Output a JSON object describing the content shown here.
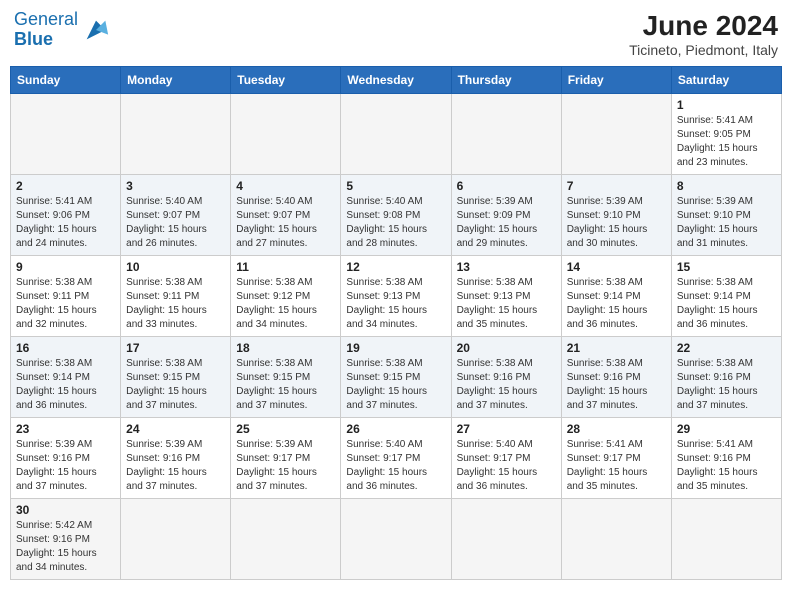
{
  "header": {
    "logo_general": "General",
    "logo_blue": "Blue",
    "title": "June 2024",
    "subtitle": "Ticineto, Piedmont, Italy"
  },
  "weekdays": [
    "Sunday",
    "Monday",
    "Tuesday",
    "Wednesday",
    "Thursday",
    "Friday",
    "Saturday"
  ],
  "weeks": [
    {
      "days": [
        {
          "num": "",
          "info": ""
        },
        {
          "num": "",
          "info": ""
        },
        {
          "num": "",
          "info": ""
        },
        {
          "num": "",
          "info": ""
        },
        {
          "num": "",
          "info": ""
        },
        {
          "num": "",
          "info": ""
        },
        {
          "num": "1",
          "info": "Sunrise: 5:41 AM\nSunset: 9:05 PM\nDaylight: 15 hours and 23 minutes."
        }
      ]
    },
    {
      "days": [
        {
          "num": "2",
          "info": "Sunrise: 5:41 AM\nSunset: 9:06 PM\nDaylight: 15 hours and 24 minutes."
        },
        {
          "num": "3",
          "info": "Sunrise: 5:40 AM\nSunset: 9:07 PM\nDaylight: 15 hours and 26 minutes."
        },
        {
          "num": "4",
          "info": "Sunrise: 5:40 AM\nSunset: 9:07 PM\nDaylight: 15 hours and 27 minutes."
        },
        {
          "num": "5",
          "info": "Sunrise: 5:40 AM\nSunset: 9:08 PM\nDaylight: 15 hours and 28 minutes."
        },
        {
          "num": "6",
          "info": "Sunrise: 5:39 AM\nSunset: 9:09 PM\nDaylight: 15 hours and 29 minutes."
        },
        {
          "num": "7",
          "info": "Sunrise: 5:39 AM\nSunset: 9:10 PM\nDaylight: 15 hours and 30 minutes."
        },
        {
          "num": "8",
          "info": "Sunrise: 5:39 AM\nSunset: 9:10 PM\nDaylight: 15 hours and 31 minutes."
        }
      ]
    },
    {
      "days": [
        {
          "num": "9",
          "info": "Sunrise: 5:38 AM\nSunset: 9:11 PM\nDaylight: 15 hours and 32 minutes."
        },
        {
          "num": "10",
          "info": "Sunrise: 5:38 AM\nSunset: 9:11 PM\nDaylight: 15 hours and 33 minutes."
        },
        {
          "num": "11",
          "info": "Sunrise: 5:38 AM\nSunset: 9:12 PM\nDaylight: 15 hours and 34 minutes."
        },
        {
          "num": "12",
          "info": "Sunrise: 5:38 AM\nSunset: 9:13 PM\nDaylight: 15 hours and 34 minutes."
        },
        {
          "num": "13",
          "info": "Sunrise: 5:38 AM\nSunset: 9:13 PM\nDaylight: 15 hours and 35 minutes."
        },
        {
          "num": "14",
          "info": "Sunrise: 5:38 AM\nSunset: 9:14 PM\nDaylight: 15 hours and 36 minutes."
        },
        {
          "num": "15",
          "info": "Sunrise: 5:38 AM\nSunset: 9:14 PM\nDaylight: 15 hours and 36 minutes."
        }
      ]
    },
    {
      "days": [
        {
          "num": "16",
          "info": "Sunrise: 5:38 AM\nSunset: 9:14 PM\nDaylight: 15 hours and 36 minutes."
        },
        {
          "num": "17",
          "info": "Sunrise: 5:38 AM\nSunset: 9:15 PM\nDaylight: 15 hours and 37 minutes."
        },
        {
          "num": "18",
          "info": "Sunrise: 5:38 AM\nSunset: 9:15 PM\nDaylight: 15 hours and 37 minutes."
        },
        {
          "num": "19",
          "info": "Sunrise: 5:38 AM\nSunset: 9:15 PM\nDaylight: 15 hours and 37 minutes."
        },
        {
          "num": "20",
          "info": "Sunrise: 5:38 AM\nSunset: 9:16 PM\nDaylight: 15 hours and 37 minutes."
        },
        {
          "num": "21",
          "info": "Sunrise: 5:38 AM\nSunset: 9:16 PM\nDaylight: 15 hours and 37 minutes."
        },
        {
          "num": "22",
          "info": "Sunrise: 5:38 AM\nSunset: 9:16 PM\nDaylight: 15 hours and 37 minutes."
        }
      ]
    },
    {
      "days": [
        {
          "num": "23",
          "info": "Sunrise: 5:39 AM\nSunset: 9:16 PM\nDaylight: 15 hours and 37 minutes."
        },
        {
          "num": "24",
          "info": "Sunrise: 5:39 AM\nSunset: 9:16 PM\nDaylight: 15 hours and 37 minutes."
        },
        {
          "num": "25",
          "info": "Sunrise: 5:39 AM\nSunset: 9:17 PM\nDaylight: 15 hours and 37 minutes."
        },
        {
          "num": "26",
          "info": "Sunrise: 5:40 AM\nSunset: 9:17 PM\nDaylight: 15 hours and 36 minutes."
        },
        {
          "num": "27",
          "info": "Sunrise: 5:40 AM\nSunset: 9:17 PM\nDaylight: 15 hours and 36 minutes."
        },
        {
          "num": "28",
          "info": "Sunrise: 5:41 AM\nSunset: 9:17 PM\nDaylight: 15 hours and 35 minutes."
        },
        {
          "num": "29",
          "info": "Sunrise: 5:41 AM\nSunset: 9:16 PM\nDaylight: 15 hours and 35 minutes."
        }
      ]
    },
    {
      "days": [
        {
          "num": "30",
          "info": "Sunrise: 5:42 AM\nSunset: 9:16 PM\nDaylight: 15 hours and 34 minutes."
        },
        {
          "num": "",
          "info": ""
        },
        {
          "num": "",
          "info": ""
        },
        {
          "num": "",
          "info": ""
        },
        {
          "num": "",
          "info": ""
        },
        {
          "num": "",
          "info": ""
        },
        {
          "num": "",
          "info": ""
        }
      ]
    }
  ]
}
